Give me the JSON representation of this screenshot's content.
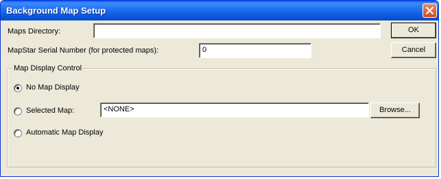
{
  "window": {
    "title": "Background Map Setup"
  },
  "fields": {
    "maps_directory_label": "Maps Directory:",
    "maps_directory_value": "",
    "serial_label": "MapStar Serial Number (for protected maps):",
    "serial_value": "0"
  },
  "buttons": {
    "ok": "OK",
    "cancel": "Cancel",
    "browse": "Browse..."
  },
  "map_display": {
    "group_label": "Map Display Control",
    "options": [
      {
        "label": "No Map Display",
        "selected": true
      },
      {
        "label": "Selected Map:",
        "selected": false
      },
      {
        "label": "Automatic Map Display",
        "selected": false
      }
    ],
    "selected_map_value": "<NONE>"
  }
}
